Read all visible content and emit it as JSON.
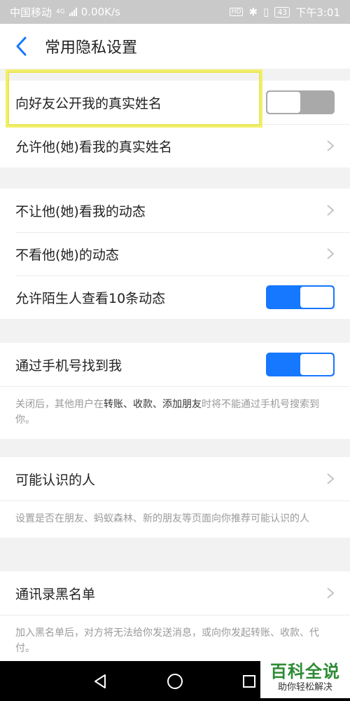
{
  "status_bar": {
    "carrier": "中国移动",
    "network": "4G",
    "speed": "0.00K/s",
    "battery": "43",
    "time": "下午3:01"
  },
  "nav": {
    "title": "常用隐私设置"
  },
  "rows": {
    "real_name_public": {
      "label": "向好友公开我的真实姓名",
      "enabled": false
    },
    "allow_view_real_name": {
      "label": "允许他(她)看我的真实姓名"
    },
    "block_view_my_feed": {
      "label": "不让他(她)看我的动态"
    },
    "hide_their_feed": {
      "label": "不看他(她)的动态"
    },
    "stranger_view_10": {
      "label": "允许陌生人查看10条动态",
      "enabled": true
    },
    "find_by_phone": {
      "label": "通过手机号找到我",
      "enabled": true
    },
    "people_you_may_know": {
      "label": "可能认识的人"
    },
    "contacts_blacklist": {
      "label": "通讯录黑名单"
    }
  },
  "notes": {
    "find_by_phone": {
      "part1": "关闭后，其他用户在",
      "highlight": "转账、收款、添加朋友",
      "part2": "时将不能通过手机号搜索到你。"
    },
    "people_you_may_know": "设置是否在朋友、蚂蚁森林、新的朋友等页面向你推荐可能认识的人",
    "contacts_blacklist": "加入黑名单后，对方将无法给你发送消息，或向你发起转账、收款、代付。"
  },
  "watermark": {
    "title": "百科全说",
    "subtitle": "助你轻松解决"
  },
  "colors": {
    "toggle_on": "#1677ff",
    "toggle_off": "#a9a9a9",
    "accent_back": "#1677ff",
    "highlight_box": "#f1f06b",
    "watermark_green": "#2e8b34"
  }
}
